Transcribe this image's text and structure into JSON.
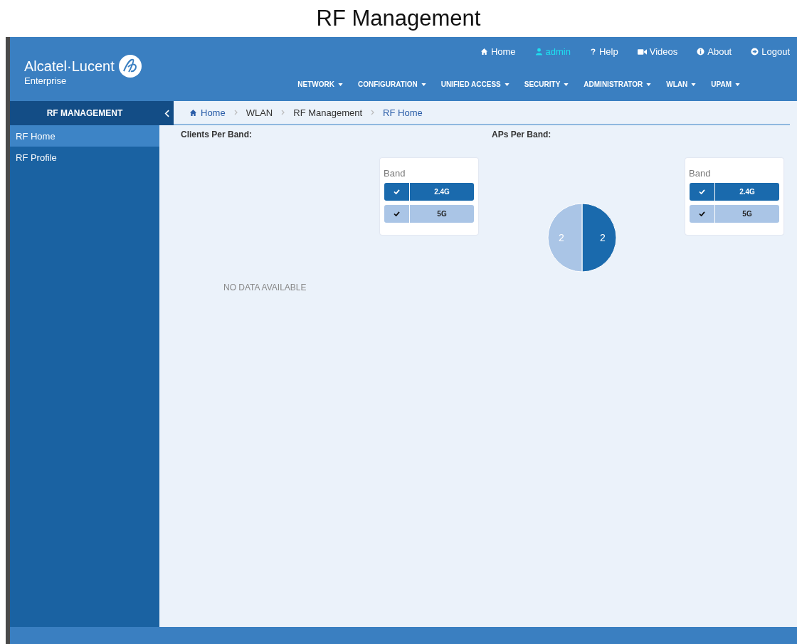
{
  "page_title": "RF Management",
  "header": {
    "logo": {
      "name": "Alcatel·Lucent",
      "sub": "Enterprise"
    },
    "top_links": [
      {
        "label": "Home",
        "selected": false
      },
      {
        "label": "admin",
        "selected": true
      },
      {
        "label": "Help",
        "selected": false
      },
      {
        "label": "Videos",
        "selected": false
      },
      {
        "label": "About",
        "selected": false
      },
      {
        "label": "Logout",
        "selected": false
      }
    ],
    "nav": [
      "NETWORK",
      "CONFIGURATION",
      "UNIFIED ACCESS",
      "SECURITY",
      "ADMINISTRATOR",
      "WLAN",
      "UPAM"
    ]
  },
  "sidebar": {
    "title": "RF MANAGEMENT",
    "items": [
      {
        "label": "RF Home",
        "selected": true
      },
      {
        "label": "RF Profile",
        "selected": false
      }
    ]
  },
  "breadcrumb": [
    {
      "label": "Home"
    },
    {
      "label": "WLAN"
    },
    {
      "label": "RF Management"
    },
    {
      "label": "RF Home"
    }
  ],
  "panels": [
    {
      "title": "Clients Per Band:",
      "empty_message": "NO DATA AVAILABLE",
      "legend": {
        "title": "Band",
        "items": [
          {
            "label": "2.4G",
            "checked": true,
            "color": "#1a6aad"
          },
          {
            "label": "5G",
            "checked": true,
            "color": "#aac5e6"
          }
        ]
      }
    },
    {
      "title": "APs Per Band:",
      "legend": {
        "title": "Band",
        "items": [
          {
            "label": "2.4G",
            "checked": true,
            "color": "#1a6aad"
          },
          {
            "label": "5G",
            "checked": true,
            "color": "#aac5e6"
          }
        ]
      },
      "chart_data": {
        "type": "pie",
        "values": [
          2,
          2
        ],
        "data_labels": true
      }
    }
  ]
}
